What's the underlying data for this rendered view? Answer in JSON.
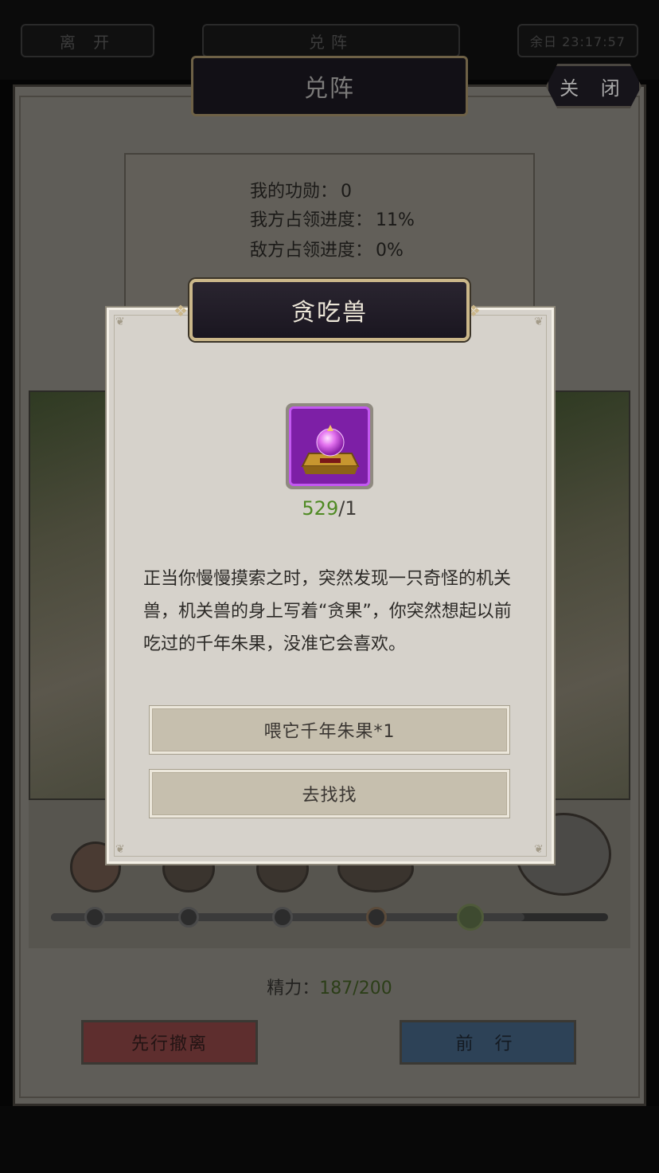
{
  "topbar": {
    "leave_label": "离 开",
    "center_label": "兑阵",
    "right_label": "余日 23:17:57"
  },
  "main": {
    "title": "兑阵",
    "close_label": "关 闭",
    "merit_label": "我的功勋：",
    "merit_value": "0",
    "our_progress_label": "我方占领进度：",
    "our_progress_value": "11%",
    "enemy_progress_label": "敌方占领进度：",
    "enemy_progress_value": "0%",
    "energy_label": "精力：",
    "energy_value": "187/200",
    "retreat_label": "先行撤离",
    "forward_label": "前 行",
    "route_progress": 0.85
  },
  "modal": {
    "title": "贪吃兽",
    "item_icon": "purple-orb-altar-icon",
    "item_have": "529",
    "item_need": "/1",
    "story": "正当你慢慢摸索之时，突然发现一只奇怪的机关兽，机关兽的身上写着“贪果”，你突然想起以前吃过的千年朱果，没准它会喜欢。",
    "option1_label": "喂它千年朱果*1",
    "option2_label": "去找找"
  },
  "colors": {
    "modal_bg": "#d6d2cb",
    "title_border": "#cbb78a",
    "item_purple": "#7d1fa6",
    "count_green": "#4f8a23"
  }
}
